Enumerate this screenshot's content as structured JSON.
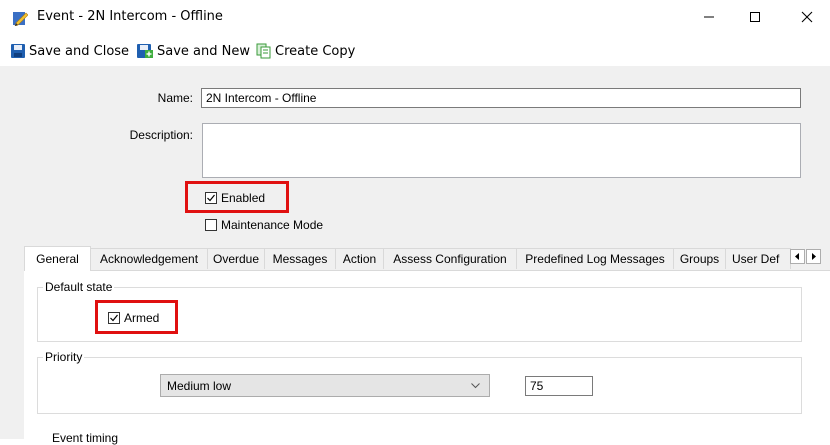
{
  "window": {
    "title": "Event  -  2N Intercom - Offline",
    "icon": "event-pencil-icon"
  },
  "toolbar": {
    "save_close_label": "Save and Close",
    "save_new_label": "Save and New",
    "create_copy_label": "Create Copy"
  },
  "form": {
    "name_label": "Name:",
    "name_value": "2N Intercom - Offline",
    "description_label": "Description:",
    "description_value": "",
    "enabled_label": "Enabled",
    "enabled_checked": true,
    "maintenance_label": "Maintenance Mode",
    "maintenance_checked": false
  },
  "tabs": [
    {
      "label": "General",
      "active": true
    },
    {
      "label": "Acknowledgement",
      "active": false
    },
    {
      "label": "Overdue",
      "active": false
    },
    {
      "label": "Messages",
      "active": false
    },
    {
      "label": "Action",
      "active": false
    },
    {
      "label": "Assess Configuration",
      "active": false
    },
    {
      "label": "Predefined Log Messages",
      "active": false
    },
    {
      "label": "Groups",
      "active": false
    },
    {
      "label": "User Def",
      "active": false
    }
  ],
  "general": {
    "default_state_title": "Default state",
    "armed_label": "Armed",
    "armed_checked": true,
    "priority_title": "Priority",
    "priority_selected": "Medium low",
    "priority_number": "75",
    "event_timing_title": "Event timing"
  },
  "colors": {
    "highlight": "#e01010",
    "form_background": "#f0f0f0"
  }
}
